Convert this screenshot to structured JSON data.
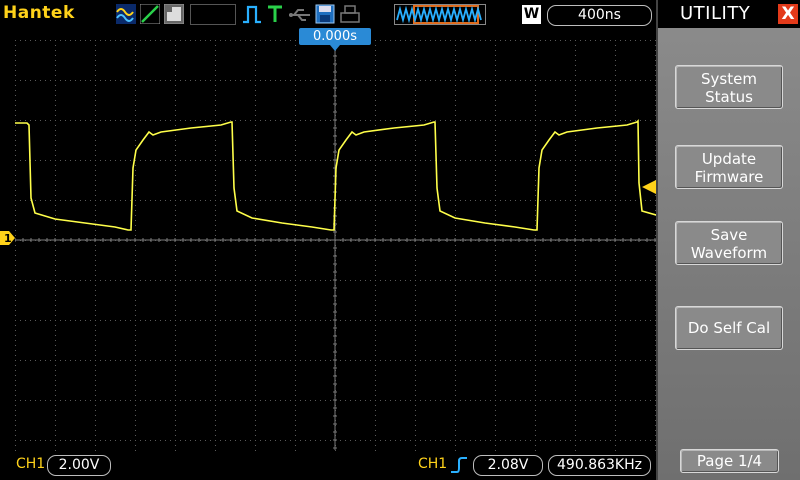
{
  "brand": "Hantek",
  "toolbar": {
    "icons": [
      "waveform-icon",
      "ramp-icon",
      "screenshot-icon",
      "blank-icon",
      "trigger-edge-icon",
      "trigger-T-icon",
      "usb-icon",
      "save-disk-icon",
      "print-icon",
      "memory-waveform-icon"
    ],
    "mode": "W",
    "timebase": "400ns"
  },
  "trigger_position": "0.000s",
  "channel_marker": "1",
  "bottom": {
    "ch1_label": "CH1",
    "ch1_volts": "2.00V",
    "trig_label": "CH1",
    "trig_level": "2.08V",
    "frequency": "490.863KHz"
  },
  "menu": {
    "title": "UTILITY",
    "close": "X",
    "buttons": [
      {
        "line1": "System",
        "line2": "Status"
      },
      {
        "line1": "Update",
        "line2": "Firmware"
      },
      {
        "line1": "Save",
        "line2": "Waveform"
      },
      {
        "line1": "Do Self Cal",
        "line2": ""
      }
    ],
    "page": "Page 1/4"
  },
  "colors": {
    "trace": "#ffff4a",
    "accent": "#2a8ad6",
    "label": "#ffd21a"
  }
}
